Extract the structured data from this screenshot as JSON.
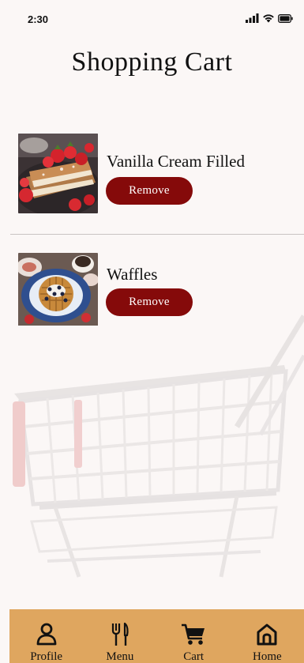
{
  "status_bar": {
    "time": "2:30",
    "icons": [
      "signal-icon",
      "wifi-icon",
      "battery-icon"
    ]
  },
  "page": {
    "title": "Shopping Cart"
  },
  "cart": {
    "items": [
      {
        "name": "Vanilla Cream Filled",
        "image": "french-toast-strawberries-image",
        "remove_label": "Remove"
      },
      {
        "name": "Waffles",
        "image": "waffles-blueberries-image",
        "remove_label": "Remove"
      }
    ]
  },
  "nav": {
    "items": [
      {
        "label": "Profile",
        "icon": "profile-icon"
      },
      {
        "label": "Menu",
        "icon": "fork-knife-icon"
      },
      {
        "label": "Cart",
        "icon": "cart-icon"
      },
      {
        "label": "Home",
        "icon": "home-icon"
      }
    ]
  },
  "colors": {
    "background": "#fbf7f6",
    "button": "#850a0a",
    "nav_bar": "#dfa65f",
    "text": "#111111"
  }
}
